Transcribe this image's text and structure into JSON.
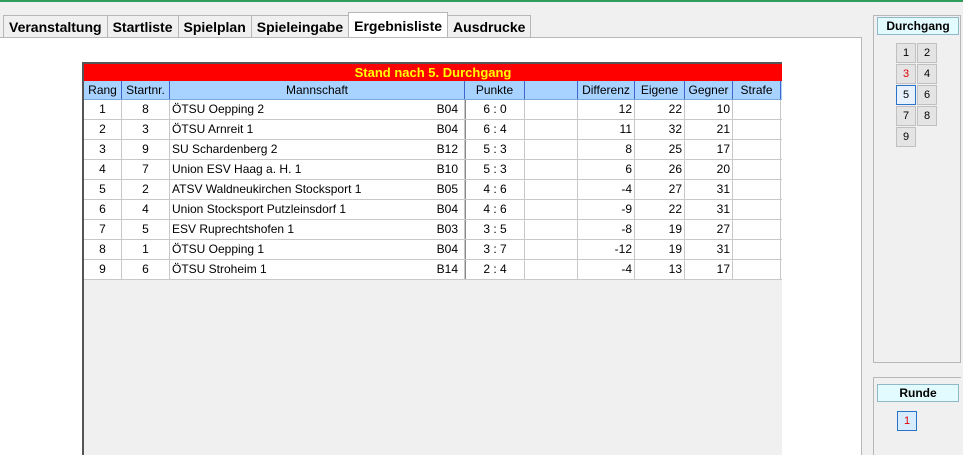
{
  "tabs": [
    "Veranstaltung",
    "Startliste",
    "Spielplan",
    "Spieleingabe",
    "Ergebnisliste",
    "Ausdrucke"
  ],
  "active_tab": "Ergebnisliste",
  "table": {
    "banner": "Stand nach 5. Durchgang",
    "headers": {
      "rang": "Rang",
      "startnr": "Startnr.",
      "mannschaft": "Mannschaft",
      "punkte": "Punkte",
      "blank": "",
      "differenz": "Differenz",
      "eigene": "Eigene",
      "gegner": "Gegner",
      "strafe": "Strafe"
    },
    "rows": [
      {
        "rang": "1",
        "startnr": "8",
        "mannschaft": "ÖTSU Oepping 2",
        "code": "B04",
        "punkte": "6 : 0",
        "differenz": "12",
        "eigene": "22",
        "gegner": "10",
        "strafe": ""
      },
      {
        "rang": "2",
        "startnr": "3",
        "mannschaft": "ÖTSU Arnreit 1",
        "code": "B04",
        "punkte": "6 : 4",
        "differenz": "11",
        "eigene": "32",
        "gegner": "21",
        "strafe": ""
      },
      {
        "rang": "3",
        "startnr": "9",
        "mannschaft": "SU Schardenberg 2",
        "code": "B12",
        "punkte": "5 : 3",
        "differenz": "8",
        "eigene": "25",
        "gegner": "17",
        "strafe": ""
      },
      {
        "rang": "4",
        "startnr": "7",
        "mannschaft": "Union ESV Haag a. H. 1",
        "code": "B10",
        "punkte": "5 : 3",
        "differenz": "6",
        "eigene": "26",
        "gegner": "20",
        "strafe": ""
      },
      {
        "rang": "5",
        "startnr": "2",
        "mannschaft": "ATSV Waldneukirchen Stocksport 1",
        "code": "B05",
        "punkte": "4 : 6",
        "differenz": "-4",
        "eigene": "27",
        "gegner": "31",
        "strafe": ""
      },
      {
        "rang": "6",
        "startnr": "4",
        "mannschaft": "Union Stocksport Putzleinsdorf 1",
        "code": "B04",
        "punkte": "4 : 6",
        "differenz": "-9",
        "eigene": "22",
        "gegner": "31",
        "strafe": ""
      },
      {
        "rang": "7",
        "startnr": "5",
        "mannschaft": "ESV Ruprechtshofen 1",
        "code": "B03",
        "punkte": "3 : 5",
        "differenz": "-8",
        "eigene": "19",
        "gegner": "27",
        "strafe": ""
      },
      {
        "rang": "8",
        "startnr": "1",
        "mannschaft": "ÖTSU Oepping 1",
        "code": "B04",
        "punkte": "3 : 7",
        "differenz": "-12",
        "eigene": "19",
        "gegner": "31",
        "strafe": ""
      },
      {
        "rang": "9",
        "startnr": "6",
        "mannschaft": "ÖTSU Stroheim 1",
        "code": "B14",
        "punkte": "2 : 4",
        "differenz": "-4",
        "eigene": "13",
        "gegner": "17",
        "strafe": ""
      }
    ]
  },
  "durchgang": {
    "title": "Durchgang",
    "buttons": [
      "1",
      "2",
      "3",
      "4",
      "5",
      "6",
      "7",
      "8",
      "9"
    ],
    "selected": "5",
    "highlighted_red": "3"
  },
  "runde": {
    "title": "Runde",
    "buttons": [
      "1"
    ],
    "selected": "1"
  },
  "colors": {
    "banner_bg": "#ff0000",
    "banner_text": "#ffff00",
    "header_bg": "#a8d2ff",
    "accent_red": "#e00000",
    "select_border": "#2a72c8"
  }
}
